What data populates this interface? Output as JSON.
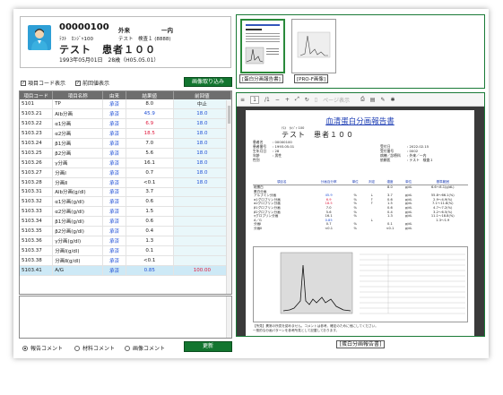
{
  "patient": {
    "id": "00000100",
    "kind": "外来",
    "ward": "一内",
    "kana": "ﾃｽﾄ　ｶﾝｼﾞｬ100",
    "dept": "テスト　検査１ (8888)",
    "name": "テスト　患者１００",
    "dob": "1993年05月01日　28歳（H05.05.01）"
  },
  "controls": {
    "show_code": "項目コード表示",
    "show_prev": "前回値表示",
    "import_button": "画像取り込み",
    "update_button": "更新"
  },
  "table": {
    "headers": [
      "項目コード",
      "項目名称",
      "由来",
      "結果値",
      "前回値"
    ],
    "rows": [
      {
        "code": "5101",
        "name": "TP",
        "src": "承済",
        "val": "8.0",
        "prev": "中止",
        "val_color": "#222222",
        "prev_color": "#222222"
      },
      {
        "code": "5103.21",
        "name": "Alb分画",
        "src": "承済",
        "val": "45.9",
        "prev": "18.0",
        "val_color": "#1f4fd6",
        "prev_color": "#1f4fd6"
      },
      {
        "code": "5103.22",
        "name": "α1分画",
        "src": "承済",
        "val": "6.9",
        "prev": "18.0",
        "val_color": "#e0183c",
        "prev_color": "#1f4fd6"
      },
      {
        "code": "5103.23",
        "name": "α2分画",
        "src": "承済",
        "val": "18.5",
        "prev": "18.0",
        "val_color": "#e0183c",
        "prev_color": "#1f4fd6"
      },
      {
        "code": "5103.24",
        "name": "β1分画",
        "src": "承済",
        "val": "7.0",
        "prev": "18.0",
        "val_color": "#222222",
        "prev_color": "#1f4fd6"
      },
      {
        "code": "5103.25",
        "name": "β2分画",
        "src": "承済",
        "val": "5.6",
        "prev": "18.0",
        "val_color": "#222222",
        "prev_color": "#1f4fd6"
      },
      {
        "code": "5103.26",
        "name": "γ分画",
        "src": "承済",
        "val": "16.1",
        "prev": "18.0",
        "val_color": "#222222",
        "prev_color": "#1f4fd6"
      },
      {
        "code": "5103.27",
        "name": "分画Ⅰ",
        "src": "承済",
        "val": "0.7",
        "prev": "18.0",
        "val_color": "#222222",
        "prev_color": "#1f4fd6"
      },
      {
        "code": "5103.28",
        "name": "分画Ⅱ",
        "src": "承済",
        "val": "<0.1",
        "prev": "18.0",
        "val_color": "#222222",
        "prev_color": "#1f4fd6"
      },
      {
        "code": "5103.31",
        "name": "Alb分画(g/dl)",
        "src": "承済",
        "val": "3.7",
        "prev": "",
        "val_color": "#222222",
        "prev_color": "#1f4fd6"
      },
      {
        "code": "5103.32",
        "name": "α1分画(g/dl)",
        "src": "承済",
        "val": "0.6",
        "prev": "",
        "val_color": "#222222",
        "prev_color": "#1f4fd6"
      },
      {
        "code": "5103.33",
        "name": "α2分画(g/dl)",
        "src": "承済",
        "val": "1.5",
        "prev": "",
        "val_color": "#222222",
        "prev_color": "#1f4fd6"
      },
      {
        "code": "5103.34",
        "name": "β1分画(g/dl)",
        "src": "承済",
        "val": "0.6",
        "prev": "",
        "val_color": "#222222",
        "prev_color": "#1f4fd6"
      },
      {
        "code": "5103.35",
        "name": "β2分画(g/dl)",
        "src": "承済",
        "val": "0.4",
        "prev": "",
        "val_color": "#222222",
        "prev_color": "#1f4fd6"
      },
      {
        "code": "5103.36",
        "name": "γ分画(g/dl)",
        "src": "承済",
        "val": "1.3",
        "prev": "",
        "val_color": "#222222",
        "prev_color": "#1f4fd6"
      },
      {
        "code": "5103.37",
        "name": "分画Ⅰ(g/dl)",
        "src": "承済",
        "val": "0.1",
        "prev": "",
        "val_color": "#222222",
        "prev_color": "#1f4fd6"
      },
      {
        "code": "5103.38",
        "name": "分画Ⅱ(g/dl)",
        "src": "承済",
        "val": "<0.1",
        "prev": "",
        "val_color": "#222222",
        "prev_color": "#1f4fd6"
      },
      {
        "code": "5103.41",
        "name": "A/G",
        "src": "承済",
        "val": "0.85",
        "prev": "100.00",
        "val_color": "#1f4fd6",
        "prev_color": "#e0183c"
      }
    ]
  },
  "comment_tabs": {
    "report": "報告コメント",
    "material": "材料コメント",
    "image": "画像コメント"
  },
  "thumbnails": [
    {
      "label": "[蛋白分画報告書]",
      "active": true
    },
    {
      "label": "[PRO-F画像]",
      "active": false
    }
  ],
  "pdf_toolbar": {
    "page": "1",
    "total": "/1",
    "fit_label": "ページ表示"
  },
  "document": {
    "title": "血清蛋白分画報告書",
    "kana": "ﾃｽﾄ　ｶﾝｼﾞｬ 100",
    "name": "テスト　患者１００",
    "meta_left_labels": [
      "患者名",
      "患者番号",
      "生年月日",
      "年齢",
      "性別"
    ],
    "meta_left_values": [
      "",
      ": 00000100",
      ": 1993.05.01",
      ": 28",
      ": 男性"
    ],
    "meta_right_labels": [
      "受付日",
      "受付番号",
      "病棟／診療科",
      "依頼医"
    ],
    "meta_right_values": [
      ": 2022.02.15",
      ": 0002",
      ": 外来／一内",
      ": テスト　検査１"
    ],
    "headers": [
      "項目名",
      "分画百分率",
      "単位",
      "判定",
      "濃度",
      "単位",
      "基準範囲"
    ],
    "rows": [
      [
        "総蛋白",
        "",
        "",
        "",
        "8.0",
        "g/dL",
        "6.6～8.1(g/dL)"
      ],
      [
        "蛋白分画",
        "",
        "",
        "",
        "",
        "",
        ""
      ],
      [
        "アルブミン分画",
        "45.9",
        "%",
        "↓",
        "3.7",
        "g/dL",
        "55.8～66.1(%)"
      ],
      [
        "α1グロブリン分画",
        "6.9",
        "%",
        "↑",
        "0.6",
        "g/dL",
        "2.9～4.9(%)"
      ],
      [
        "α2グロブリン分画",
        "18.5",
        "%",
        "↑",
        "1.5",
        "g/dL",
        "7.1～11.8(%)"
      ],
      [
        "β1グロブリン分画",
        "7.0",
        "%",
        "",
        "0.6",
        "g/dL",
        "4.7～7.2(%)"
      ],
      [
        "β2グロブリン分画",
        "5.6",
        "%",
        "",
        "0.4",
        "g/dL",
        "3.2～6.5(%)"
      ],
      [
        "γグロブリン分画",
        "16.1",
        "%",
        "",
        "1.3",
        "g/dL",
        "11.1～18.8(%)"
      ],
      [
        "A／G",
        "0.85",
        "",
        "↓",
        "",
        "",
        "1.3～1.9"
      ],
      [
        "分画Ⅰ",
        "0.7",
        "%",
        "",
        "0.1",
        "g/dL",
        ""
      ],
      [
        "分画Ⅱ",
        "<0.1",
        "%",
        "",
        "<0.1",
        "g/dL",
        ""
      ]
    ],
    "note": "【所見】異常の所見を認めません。コメントは参考。確定のために他にしてください。",
    "note2": "一般的な分画パターンを参考所見として記載しております。"
  },
  "viewer_caption": "[蛋白分画報告書]",
  "colors": {
    "accent": "#12752f",
    "blue": "#1f4fd6",
    "red": "#e0183c"
  }
}
